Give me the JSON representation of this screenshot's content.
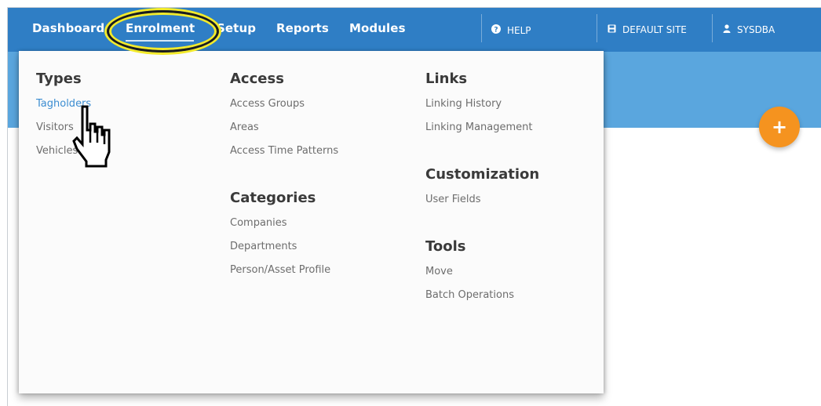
{
  "nav": {
    "dashboard": "Dashboard",
    "enrolment": "Enrolment",
    "setup": "Setup",
    "reports": "Reports",
    "modules": "Modules"
  },
  "header_right": {
    "help": "HELP",
    "site": "DEFAULT SITE",
    "user": "SYSDBA"
  },
  "menu": {
    "types": {
      "heading": "Types",
      "items": [
        "Tagholders",
        "Visitors",
        "Vehicles"
      ]
    },
    "access": {
      "heading": "Access",
      "items": [
        "Access Groups",
        "Areas",
        "Access Time Patterns"
      ]
    },
    "categories": {
      "heading": "Categories",
      "items": [
        "Companies",
        "Departments",
        "Person/Asset Profile"
      ]
    },
    "links": {
      "heading": "Links",
      "items": [
        "Linking History",
        "Linking Management"
      ]
    },
    "customization": {
      "heading": "Customization",
      "items": [
        "User Fields"
      ]
    },
    "tools": {
      "heading": "Tools",
      "items": [
        "Move",
        "Batch Operations"
      ]
    }
  },
  "fab": {
    "label": "+"
  },
  "icons": {
    "help": "help-circle-icon",
    "site": "save-disk-icon",
    "user": "user-icon",
    "pointer": "hand-pointer-icon"
  },
  "colors": {
    "topbar": "#2f7ec5",
    "subbar": "#5aa6de",
    "accent_orange": "#f5931f",
    "link_active": "#3c8dd1",
    "highlight_yellow": "#f3ea2a"
  }
}
